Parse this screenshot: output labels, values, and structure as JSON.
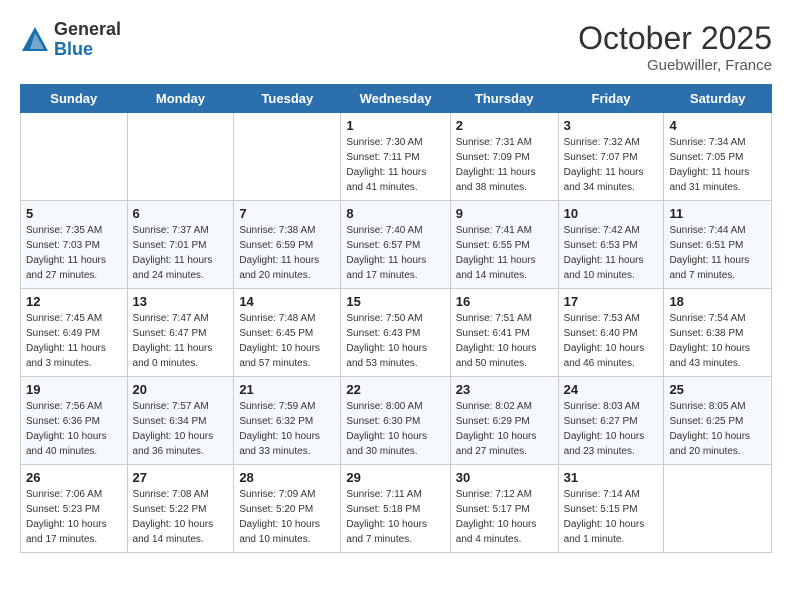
{
  "header": {
    "logo_general": "General",
    "logo_blue": "Blue",
    "month": "October 2025",
    "location": "Guebwiller, France"
  },
  "weekdays": [
    "Sunday",
    "Monday",
    "Tuesday",
    "Wednesday",
    "Thursday",
    "Friday",
    "Saturday"
  ],
  "weeks": [
    [
      {
        "day": "",
        "info": ""
      },
      {
        "day": "",
        "info": ""
      },
      {
        "day": "",
        "info": ""
      },
      {
        "day": "1",
        "info": "Sunrise: 7:30 AM\nSunset: 7:11 PM\nDaylight: 11 hours\nand 41 minutes."
      },
      {
        "day": "2",
        "info": "Sunrise: 7:31 AM\nSunset: 7:09 PM\nDaylight: 11 hours\nand 38 minutes."
      },
      {
        "day": "3",
        "info": "Sunrise: 7:32 AM\nSunset: 7:07 PM\nDaylight: 11 hours\nand 34 minutes."
      },
      {
        "day": "4",
        "info": "Sunrise: 7:34 AM\nSunset: 7:05 PM\nDaylight: 11 hours\nand 31 minutes."
      }
    ],
    [
      {
        "day": "5",
        "info": "Sunrise: 7:35 AM\nSunset: 7:03 PM\nDaylight: 11 hours\nand 27 minutes."
      },
      {
        "day": "6",
        "info": "Sunrise: 7:37 AM\nSunset: 7:01 PM\nDaylight: 11 hours\nand 24 minutes."
      },
      {
        "day": "7",
        "info": "Sunrise: 7:38 AM\nSunset: 6:59 PM\nDaylight: 11 hours\nand 20 minutes."
      },
      {
        "day": "8",
        "info": "Sunrise: 7:40 AM\nSunset: 6:57 PM\nDaylight: 11 hours\nand 17 minutes."
      },
      {
        "day": "9",
        "info": "Sunrise: 7:41 AM\nSunset: 6:55 PM\nDaylight: 11 hours\nand 14 minutes."
      },
      {
        "day": "10",
        "info": "Sunrise: 7:42 AM\nSunset: 6:53 PM\nDaylight: 11 hours\nand 10 minutes."
      },
      {
        "day": "11",
        "info": "Sunrise: 7:44 AM\nSunset: 6:51 PM\nDaylight: 11 hours\nand 7 minutes."
      }
    ],
    [
      {
        "day": "12",
        "info": "Sunrise: 7:45 AM\nSunset: 6:49 PM\nDaylight: 11 hours\nand 3 minutes."
      },
      {
        "day": "13",
        "info": "Sunrise: 7:47 AM\nSunset: 6:47 PM\nDaylight: 11 hours\nand 0 minutes."
      },
      {
        "day": "14",
        "info": "Sunrise: 7:48 AM\nSunset: 6:45 PM\nDaylight: 10 hours\nand 57 minutes."
      },
      {
        "day": "15",
        "info": "Sunrise: 7:50 AM\nSunset: 6:43 PM\nDaylight: 10 hours\nand 53 minutes."
      },
      {
        "day": "16",
        "info": "Sunrise: 7:51 AM\nSunset: 6:41 PM\nDaylight: 10 hours\nand 50 minutes."
      },
      {
        "day": "17",
        "info": "Sunrise: 7:53 AM\nSunset: 6:40 PM\nDaylight: 10 hours\nand 46 minutes."
      },
      {
        "day": "18",
        "info": "Sunrise: 7:54 AM\nSunset: 6:38 PM\nDaylight: 10 hours\nand 43 minutes."
      }
    ],
    [
      {
        "day": "19",
        "info": "Sunrise: 7:56 AM\nSunset: 6:36 PM\nDaylight: 10 hours\nand 40 minutes."
      },
      {
        "day": "20",
        "info": "Sunrise: 7:57 AM\nSunset: 6:34 PM\nDaylight: 10 hours\nand 36 minutes."
      },
      {
        "day": "21",
        "info": "Sunrise: 7:59 AM\nSunset: 6:32 PM\nDaylight: 10 hours\nand 33 minutes."
      },
      {
        "day": "22",
        "info": "Sunrise: 8:00 AM\nSunset: 6:30 PM\nDaylight: 10 hours\nand 30 minutes."
      },
      {
        "day": "23",
        "info": "Sunrise: 8:02 AM\nSunset: 6:29 PM\nDaylight: 10 hours\nand 27 minutes."
      },
      {
        "day": "24",
        "info": "Sunrise: 8:03 AM\nSunset: 6:27 PM\nDaylight: 10 hours\nand 23 minutes."
      },
      {
        "day": "25",
        "info": "Sunrise: 8:05 AM\nSunset: 6:25 PM\nDaylight: 10 hours\nand 20 minutes."
      }
    ],
    [
      {
        "day": "26",
        "info": "Sunrise: 7:06 AM\nSunset: 5:23 PM\nDaylight: 10 hours\nand 17 minutes."
      },
      {
        "day": "27",
        "info": "Sunrise: 7:08 AM\nSunset: 5:22 PM\nDaylight: 10 hours\nand 14 minutes."
      },
      {
        "day": "28",
        "info": "Sunrise: 7:09 AM\nSunset: 5:20 PM\nDaylight: 10 hours\nand 10 minutes."
      },
      {
        "day": "29",
        "info": "Sunrise: 7:11 AM\nSunset: 5:18 PM\nDaylight: 10 hours\nand 7 minutes."
      },
      {
        "day": "30",
        "info": "Sunrise: 7:12 AM\nSunset: 5:17 PM\nDaylight: 10 hours\nand 4 minutes."
      },
      {
        "day": "31",
        "info": "Sunrise: 7:14 AM\nSunset: 5:15 PM\nDaylight: 10 hours\nand 1 minute."
      },
      {
        "day": "",
        "info": ""
      }
    ]
  ]
}
